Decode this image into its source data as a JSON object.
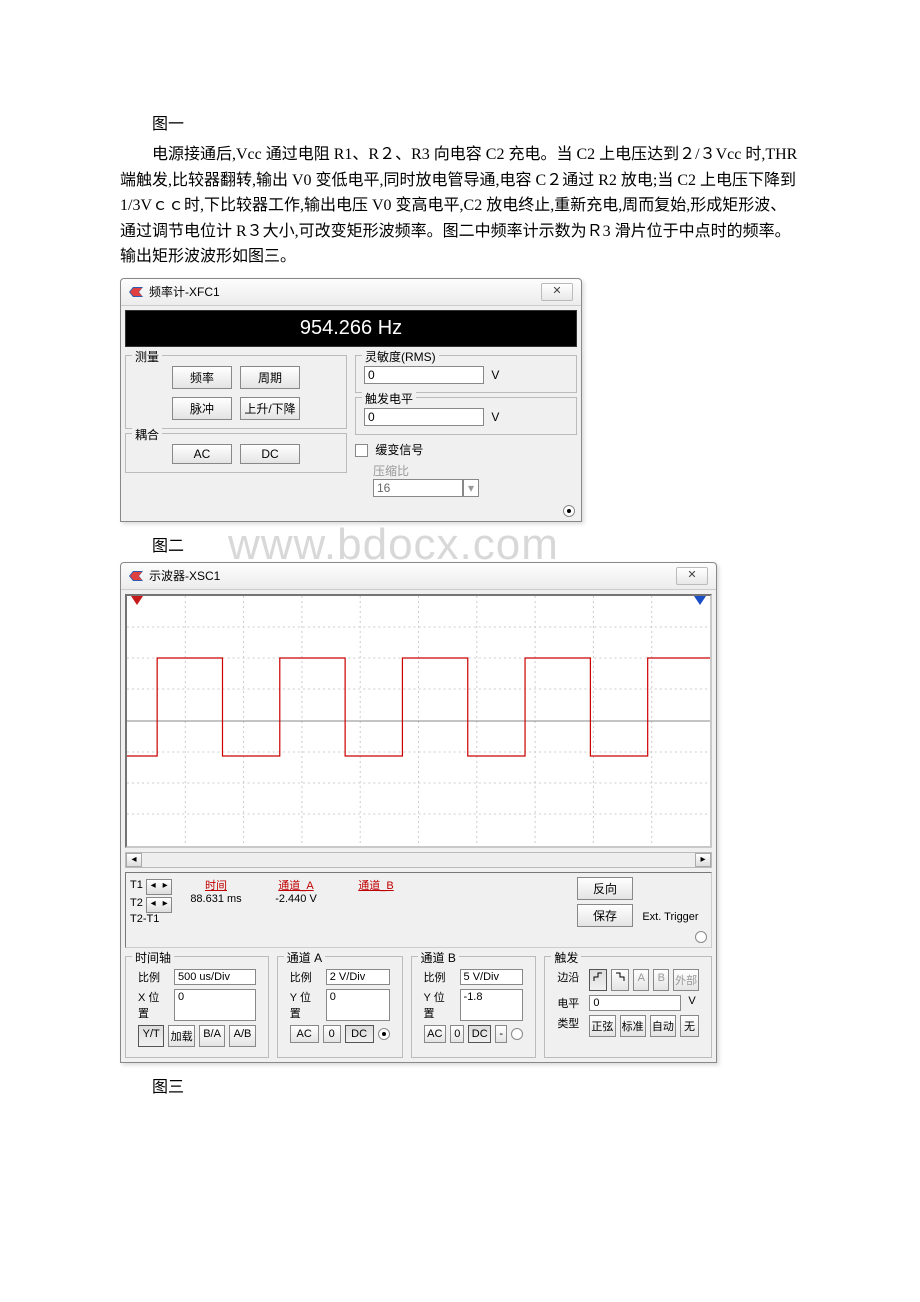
{
  "caption_fig1": "图一",
  "paragraph": "电源接通后,Vcc 通过电阻 R1、R２、R3 向电容 C2 充电。当 C2 上电压达到２/３Vcc 时,THR 端触发,比较器翻转,输出 V0 变低电平,同时放电管导通,电容 C２通过 R2 放电;当 C2 上电压下降到 1/3Vｃｃ时,下比较器工作,输出电压 V0 变高电平,C2 放电终止,重新充电,周而复始,形成矩形波、通过调节电位计 R３大小,可改变矩形波频率。图二中频率计示数为Ｒ3 滑片位于中点时的频率。输出矩形波波形如图三。",
  "caption_fig2": "图二",
  "caption_fig3": "图三",
  "watermark": "www.bdocx.com",
  "freq_counter": {
    "title": "频率计-XFC1",
    "display": "954.266 Hz",
    "group_measure": "测量",
    "btn_freq": "频率",
    "btn_period": "周期",
    "btn_pulse": "脉冲",
    "btn_rise_fall": "上升/下降",
    "group_coupling": "耦合",
    "btn_ac": "AC",
    "btn_dc": "DC",
    "group_sensitivity": "灵敏度(RMS)",
    "sens_value": "0",
    "sens_unit": "V",
    "group_trigger": "触发电平",
    "trig_value": "0",
    "trig_unit": "V",
    "chk_slow": "缓变信号",
    "lbl_ratio": "压缩比",
    "ratio_value": "16"
  },
  "scope": {
    "title": "示波器-XSC1",
    "cursor": {
      "t1": "T1",
      "t2": "T2",
      "delta": "T2-T1",
      "hdr_time": "时间",
      "hdr_chA": "通道_A",
      "hdr_chB": "通道_B",
      "t1_time": "88.631 ms",
      "t1_chA": "-2.440 V",
      "btn_reverse": "反向",
      "btn_save": "保存",
      "btn_ext": "Ext. Trigger"
    },
    "timebase": {
      "title": "时间轴",
      "scale_lbl": "比例",
      "scale_val": "500 us/Div",
      "xpos_lbl": "X 位置",
      "xpos_val": "0",
      "btn_yt": "Y/T",
      "btn_add": "加载",
      "btn_ba": "B/A",
      "btn_ab": "A/B"
    },
    "chA": {
      "title": "通道 A",
      "scale_lbl": "比例",
      "scale_val": "2 V/Div",
      "ypos_lbl": "Y 位置",
      "ypos_val": "0",
      "btn_ac": "AC",
      "btn_0": "0",
      "btn_dc": "DC"
    },
    "chB": {
      "title": "通道 B",
      "scale_lbl": "比例",
      "scale_val": "5 V/Div",
      "ypos_lbl": "Y 位置",
      "ypos_val": "-1.8",
      "btn_ac": "AC",
      "btn_0": "0",
      "btn_dc": "DC",
      "btn_minus": "-"
    },
    "trigger": {
      "title": "触发",
      "edge_lbl": "边沿",
      "btn_A": "A",
      "btn_B": "B",
      "btn_ext": "外部",
      "level_lbl": "电平",
      "level_val": "0",
      "level_unit": "V",
      "type_lbl": "类型",
      "btn_sine": "正弦",
      "btn_norm": "标准",
      "btn_auto": "自动",
      "btn_none": "无"
    }
  }
}
